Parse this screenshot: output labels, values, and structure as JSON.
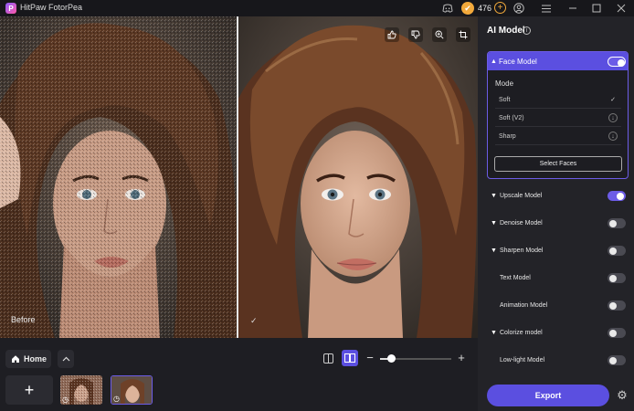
{
  "app": {
    "logo_letter": "P",
    "title": "HitPaw FotorPea"
  },
  "titlebar": {
    "credits": "476",
    "coin_symbol": "✔",
    "plus_symbol": "+"
  },
  "canvas": {
    "before_label": "Before"
  },
  "bottom": {
    "home_label": "Home",
    "add_symbol": "+"
  },
  "panel": {
    "title": "AI Model",
    "face_model": {
      "label": "Face Model",
      "enabled": true,
      "mode_label": "Mode",
      "options": [
        {
          "label": "Soft",
          "state": "selected"
        },
        {
          "label": "Soft (V2)",
          "state": "download"
        },
        {
          "label": "Sharp",
          "state": "download"
        }
      ],
      "select_faces_label": "Select Faces"
    },
    "models": [
      {
        "label": "Upscale Model",
        "expandable": true,
        "enabled": true
      },
      {
        "label": "Denoise Model",
        "expandable": true,
        "enabled": false
      },
      {
        "label": "Sharpen Model",
        "expandable": true,
        "enabled": false
      },
      {
        "label": "Text Model",
        "expandable": false,
        "enabled": false
      },
      {
        "label": "Animation Model",
        "expandable": false,
        "enabled": false
      },
      {
        "label": "Colorize model",
        "expandable": true,
        "enabled": false
      },
      {
        "label": "Low-light Model",
        "expandable": false,
        "enabled": false
      }
    ],
    "export_label": "Export"
  },
  "icons": {
    "logo": "app-logo-icon",
    "discord": "discord-icon",
    "account": "account-icon",
    "menu": "menu-icon",
    "minimize": "minimize-icon",
    "maximize": "maximize-icon",
    "close": "close-icon",
    "thumb_up": "thumb-up-icon",
    "thumb_down": "thumb-down-icon",
    "zoom_in": "zoom-in-icon",
    "crop": "crop-icon",
    "home": "home-icon",
    "chevron_up": "chevron-up-icon",
    "split_view": "split-view-icon",
    "side_by_side": "side-by-side-icon",
    "settings": "gear-icon"
  },
  "colors": {
    "accent": "#5b4fe0",
    "panel_bg": "#232328",
    "coin": "#f2a93b"
  }
}
